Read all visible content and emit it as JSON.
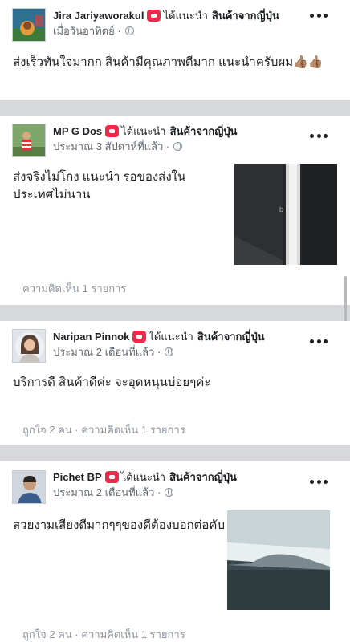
{
  "reviews": [
    {
      "author": "Jira Jariyaworakul",
      "recommend_text": "ได้แนะนำ",
      "page": "สินค้าจากญี่ปุ่น",
      "time": "เมื่อวันอาทิตย์ ·",
      "text": "ส่งเร็วทันใจมากก สินค้ามีคุณภาพดีมาก แนะนำครับผม👍🏽👍🏽",
      "footer": "",
      "avatar_icon": "avatar-landscape-icon"
    },
    {
      "author": "MP G Dos",
      "recommend_text": "ได้แนะนำ",
      "page": "สินค้าจากญี่ปุ่น",
      "time": "ประมาณ 3 สัปดาห์ที่แล้ว ·",
      "text": "ส่งจริงไม่โกง แนะนำ รอของส่งในประเทศไม่นาน",
      "footer": "ความคิดเห็น 1 รายการ",
      "avatar_icon": "avatar-person-outdoor-icon"
    },
    {
      "author": "Naripan Pinnok",
      "recommend_text": "ได้แนะนำ",
      "page": "สินค้าจากญี่ปุ่น",
      "time": "ประมาณ 2 เดือนที่แล้ว ·",
      "text": "บริการดี สินค้าดีค่ะ จะอุดหนุนบ่อยๆค่ะ",
      "footer": "ถูกใจ 2 คน · ความคิดเห็น 1 รายการ",
      "avatar_icon": "avatar-woman-portrait-icon"
    },
    {
      "author": "Pichet BP",
      "recommend_text": "ได้แนะนำ",
      "page": "สินค้าจากญี่ปุ่น",
      "time": "ประมาณ 2 เดือนที่แล้ว ·",
      "text": "สวยงามเสียงดีมากๆๆของดีต้องบอกต่อคับ",
      "footer": "ถูกใจ 2 คน · ความคิดเห็น 1 รายการ",
      "avatar_icon": "avatar-man-portrait-icon"
    }
  ],
  "colors": {
    "divider": "#d8d9dd",
    "recommend_badge": "#f02849",
    "meta_text": "#606770",
    "footer_text": "#8d949e"
  },
  "icons": {
    "recommend": "recommend-badge-icon",
    "audience": "globe-icon",
    "more": "more-options-icon"
  }
}
